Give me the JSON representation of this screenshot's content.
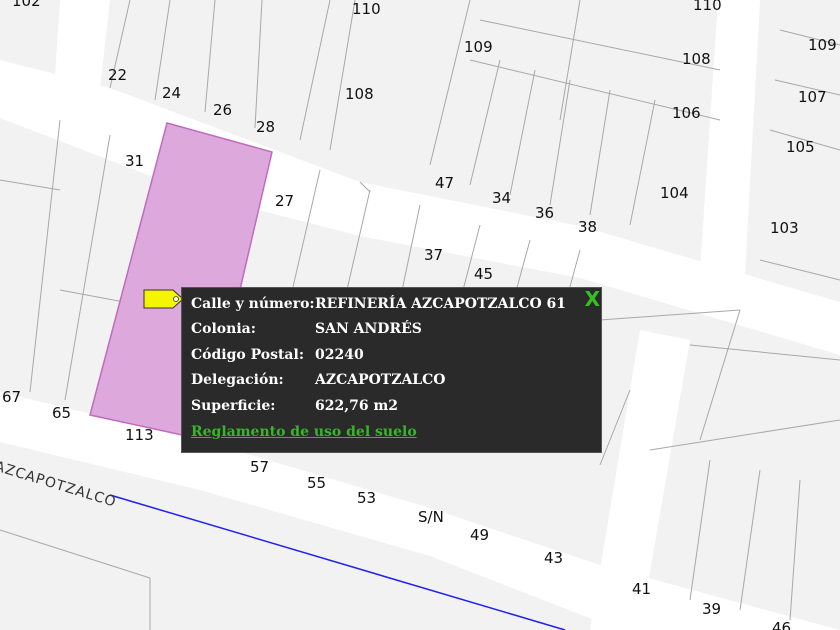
{
  "map": {
    "lot_numbers": [
      {
        "label": "102"
      },
      {
        "label": "110"
      },
      {
        "label": "110"
      },
      {
        "label": "109"
      },
      {
        "label": "108"
      },
      {
        "label": "109"
      },
      {
        "label": "107"
      },
      {
        "label": "106"
      },
      {
        "label": "105"
      },
      {
        "label": "22"
      },
      {
        "label": "24"
      },
      {
        "label": "26"
      },
      {
        "label": "28"
      },
      {
        "label": "108"
      },
      {
        "label": "31"
      },
      {
        "label": "27"
      },
      {
        "label": "47"
      },
      {
        "label": "34"
      },
      {
        "label": "36"
      },
      {
        "label": "38"
      },
      {
        "label": "104"
      },
      {
        "label": "103"
      },
      {
        "label": "37"
      },
      {
        "label": "45"
      },
      {
        "label": "67"
      },
      {
        "label": "65"
      },
      {
        "label": "113"
      },
      {
        "label": "57"
      },
      {
        "label": "55"
      },
      {
        "label": "53"
      },
      {
        "label": "S/N"
      },
      {
        "label": "49"
      },
      {
        "label": "43"
      },
      {
        "label": "41"
      },
      {
        "label": "39"
      },
      {
        "label": "46"
      }
    ],
    "street_name": "AZCAPOTZALCO",
    "highlight_color": "#dda8dc",
    "highlight_stroke": "#c06bc0",
    "route_color": "#1f1ff0",
    "pin_color": "#f5f500"
  },
  "popup": {
    "rows": [
      {
        "key": "Calle y número:",
        "value": "REFINERÍA AZCAPOTZALCO 61"
      },
      {
        "key": "Colonia:",
        "value": "SAN ANDRÉS"
      },
      {
        "key": "Código Postal:",
        "value": "02240"
      },
      {
        "key": "Delegación:",
        "value": "AZCAPOTZALCO"
      },
      {
        "key": "Superficie:",
        "value": "622,76 m2"
      }
    ],
    "link_label": "Reglamento de uso del suelo",
    "close_label": "X",
    "background": "#2a2a2a",
    "link_color": "#39b52b",
    "close_color": "#34c021"
  }
}
